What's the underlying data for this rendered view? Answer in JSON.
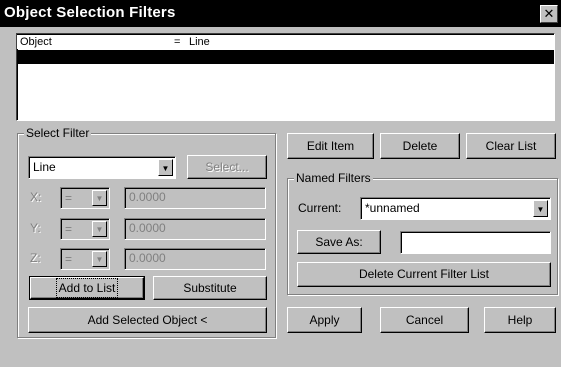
{
  "window": {
    "title": "Object Selection Filters",
    "close_glyph": "✕"
  },
  "filter_list": {
    "rows": [
      {
        "property": "Object",
        "operator": "=",
        "value": "Line"
      },
      {
        "property": "",
        "operator": "",
        "value": ""
      }
    ]
  },
  "select_filter": {
    "label": "Select Filter",
    "type_value": "Line",
    "select_button": "Select...",
    "coords": [
      {
        "axis": "X:",
        "operator": "=",
        "value": "0.0000"
      },
      {
        "axis": "Y:",
        "operator": "=",
        "value": "0.0000"
      },
      {
        "axis": "Z:",
        "operator": "=",
        "value": "0.0000"
      }
    ],
    "add_to_list": "Add to List",
    "substitute": "Substitute",
    "add_selected": "Add Selected Object <"
  },
  "list_buttons": {
    "edit_item": "Edit Item",
    "delete": "Delete",
    "clear_list": "Clear List"
  },
  "named_filters": {
    "label": "Named Filters",
    "current_label": "Current:",
    "current_value": "*unnamed",
    "save_as": "Save As:",
    "save_as_value": "",
    "delete_current": "Delete Current Filter List"
  },
  "footer": {
    "apply": "Apply",
    "cancel": "Cancel",
    "help": "Help"
  }
}
